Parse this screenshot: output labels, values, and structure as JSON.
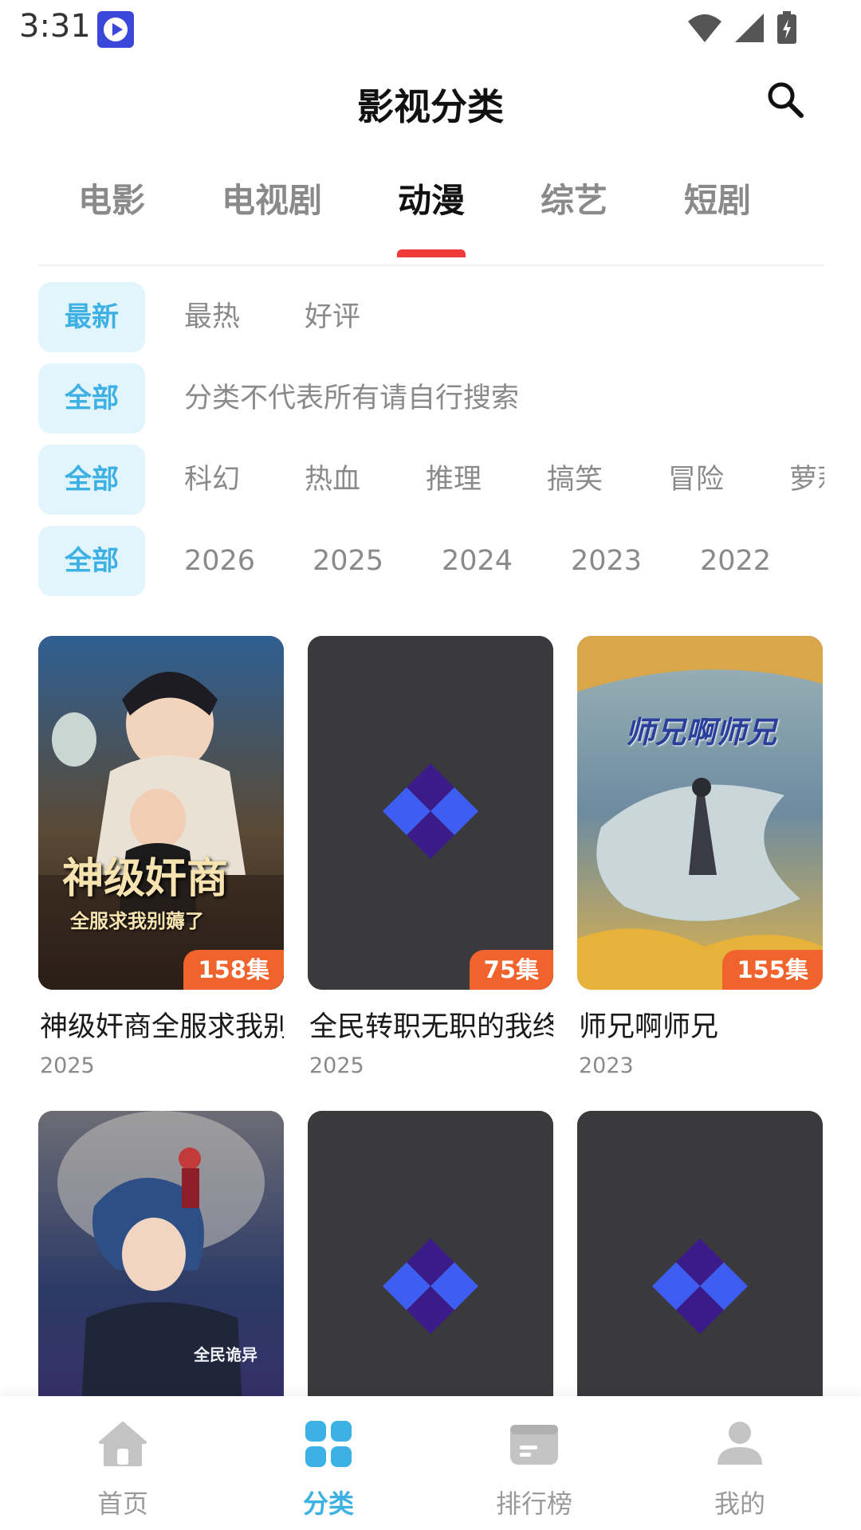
{
  "status_bar": {
    "time": "3:31"
  },
  "header": {
    "title": "影视分类"
  },
  "tabs": [
    {
      "label": "电影"
    },
    {
      "label": "电视剧"
    },
    {
      "label": "动漫",
      "active": true
    },
    {
      "label": "综艺"
    },
    {
      "label": "短剧"
    }
  ],
  "filters": {
    "sort": {
      "selected": "最新",
      "options": [
        "最热",
        "好评"
      ]
    },
    "category": {
      "selected": "全部",
      "note": "分类不代表所有请自行搜索"
    },
    "genre": {
      "selected": "全部",
      "options": [
        "科幻",
        "热血",
        "推理",
        "搞笑",
        "冒险",
        "萝莉"
      ]
    },
    "year": {
      "selected": "全部",
      "options": [
        "2026",
        "2025",
        "2024",
        "2023",
        "2022"
      ]
    }
  },
  "items": [
    {
      "title": "神级奸商全服求我别薅了",
      "year": "2025",
      "episodes": "158集",
      "poster_title": "神级奸商",
      "poster_subtitle": "全服求我别薅了"
    },
    {
      "title": "全民转职无职的我终结了",
      "year": "2025",
      "episodes": "75集"
    },
    {
      "title": "师兄啊师兄",
      "year": "2023",
      "episodes": "155集",
      "poster_title": "师兄啊师兄"
    },
    {
      "title": "",
      "year": "",
      "episodes": "",
      "poster_tag": "全民诡异"
    },
    {
      "title": "",
      "year": "",
      "episodes": ""
    },
    {
      "title": "",
      "year": "",
      "episodes": ""
    }
  ],
  "bottom_nav": [
    {
      "label": "首页",
      "icon": "home-icon"
    },
    {
      "label": "分类",
      "icon": "category-grid-icon",
      "active": true
    },
    {
      "label": "排行榜",
      "icon": "ranking-icon"
    },
    {
      "label": "我的",
      "icon": "profile-icon"
    }
  ],
  "colors": {
    "accent": "#3db0e4",
    "tab_indicator": "#f03a3a",
    "badge": "#f0632d",
    "placeholder": "#3a3a3d"
  }
}
